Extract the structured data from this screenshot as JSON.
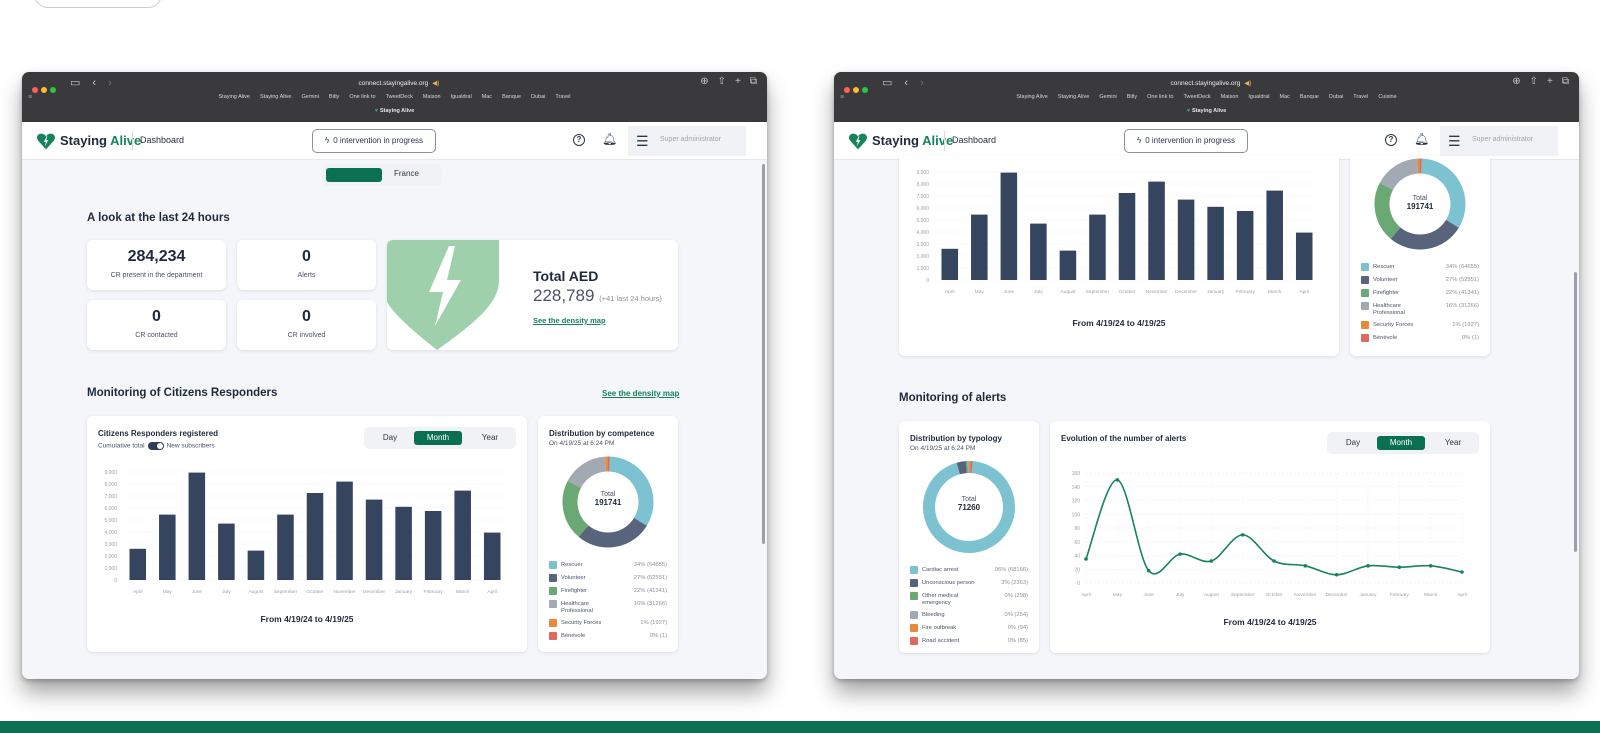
{
  "browser": {
    "url": "connect.stayingalive.org",
    "tab_title": "Staying Alive",
    "bookmarks": [
      "Staying Alive",
      "Staying Alive",
      "Gemini",
      "Bitly",
      "One link to",
      "TweetDeck",
      "Maison",
      "Igualdral",
      "Mac",
      "Banque",
      "Dubai",
      "Travel",
      "Cuisine"
    ]
  },
  "app": {
    "brand_part1": "Staying",
    "brand_part2": "Alive",
    "nav_dashboard": "Dashboard",
    "intervention_label": "0 intervention in progress",
    "user_role": "Super administrator",
    "help_glyph": "?",
    "colors": {
      "primary": "#0a7050",
      "accent": "#16835a",
      "bar": "#36455f",
      "heart_light": "#9fd0ac"
    }
  },
  "left": {
    "country_tab": "France",
    "last24_title": "A look at the last 24 hours",
    "kpis": [
      {
        "value": "284,234",
        "label": "CR present in the department"
      },
      {
        "value": "0",
        "label": "Alerts"
      },
      {
        "value": "0",
        "label": "CR contacted"
      },
      {
        "value": "0",
        "label": "CR involved"
      }
    ],
    "aed": {
      "title": "Total AED",
      "value": "228,789",
      "delta": "(+41 last 24 hours)",
      "link": "See the density map"
    },
    "monitoring_title": "Monitoring of Citizens Responders",
    "monitoring_link": "See the density map",
    "cr_card": {
      "title": "Citizens Responders registered",
      "cumulative": "Cumulative total",
      "new_subscribers": "New subscribers",
      "periods": [
        "Day",
        "Month",
        "Year"
      ],
      "active_period": "Month",
      "footer": "From 4/19/24 to 4/19/25"
    },
    "competence": {
      "title": "Distribution by competence",
      "date": "On 4/19/25 at 6:24 PM",
      "total_label": "Total",
      "total_value": "191741"
    }
  },
  "right": {
    "bars_footer": "From 4/19/24 to 4/19/25",
    "competence_total_label": "Total",
    "competence_total_value": "191741",
    "alerts_title": "Monitoring of alerts",
    "typology": {
      "title": "Distribution by typology",
      "date": "On 4/19/25 at 6:24 PM",
      "total_label": "Total",
      "total_value": "71260"
    },
    "evolution": {
      "title": "Evolution of the number of alerts",
      "periods": [
        "Day",
        "Month",
        "Year"
      ],
      "active_period": "Month",
      "footer": "From 4/19/24 to 4/19/25"
    }
  },
  "chart_data": [
    {
      "type": "bar",
      "title": "Citizens Responders registered",
      "categories": [
        "April",
        "May",
        "June",
        "July",
        "August",
        "September",
        "October",
        "November",
        "December",
        "January",
        "February",
        "March",
        "April"
      ],
      "values": [
        2600,
        5450,
        8950,
        4700,
        2450,
        5450,
        7250,
        8200,
        6700,
        6100,
        5750,
        7450,
        3950
      ],
      "yticks": [
        "0",
        "1,000",
        "2,000",
        "3,000",
        "4,000",
        "5,000",
        "6,000",
        "7,000",
        "8,000",
        "9,000"
      ],
      "ylim": [
        0,
        9000
      ],
      "grid": true
    },
    {
      "type": "pie",
      "title": "Distribution by competence",
      "total": 191741,
      "slices": [
        {
          "name": "Rescuer",
          "label": "34% (64655)",
          "value": 64655,
          "color": "#7cc2d0"
        },
        {
          "name": "Volunteer",
          "label": "27% (52551)",
          "value": 52551,
          "color": "#57647c"
        },
        {
          "name": "Firefighter",
          "label": "22% (41341)",
          "value": 41341,
          "color": "#6aa973"
        },
        {
          "name": "Healthcare Professional",
          "label": "16% (31266)",
          "value": 31266,
          "color": "#a3a9b2"
        },
        {
          "name": "Security Forces",
          "label": "1% (1927)",
          "value": 1927,
          "color": "#e98a3b"
        },
        {
          "name": "Bénévole",
          "label": "0% (1)",
          "value": 1,
          "color": "#e1685c"
        }
      ]
    },
    {
      "type": "pie",
      "title": "Distribution by typology",
      "total": 71260,
      "slices": [
        {
          "name": "Cardiac arrest",
          "label": "96% (68166)",
          "value": 68166,
          "color": "#7cc2d0"
        },
        {
          "name": "Unconscious person",
          "label": "3% (2363)",
          "value": 2363,
          "color": "#57647c"
        },
        {
          "name": "Other medical emergency",
          "label": "0% (298)",
          "value": 298,
          "color": "#6aa973"
        },
        {
          "name": "Bleeding",
          "label": "0% (254)",
          "value": 254,
          "color": "#a3a9b2"
        },
        {
          "name": "Fire outbreak",
          "label": "0% (94)",
          "value": 94,
          "color": "#e98a3b"
        },
        {
          "name": "Road accident",
          "label": "0% (85)",
          "value": 85,
          "color": "#e1685c"
        }
      ]
    },
    {
      "type": "line",
      "title": "Evolution of the number of alerts",
      "categories": [
        "April",
        "May",
        "June",
        "July",
        "August",
        "September",
        "October",
        "November",
        "December",
        "January",
        "February",
        "March",
        "April"
      ],
      "values": [
        35,
        150,
        18,
        42,
        32,
        70,
        32,
        25,
        12,
        25,
        23,
        25,
        16
      ],
      "yticks": [
        "0",
        "20",
        "40",
        "60",
        "80",
        "100",
        "120",
        "140",
        "160"
      ],
      "ylim": [
        0,
        160
      ],
      "grid": true,
      "color": "#16835a"
    }
  ]
}
